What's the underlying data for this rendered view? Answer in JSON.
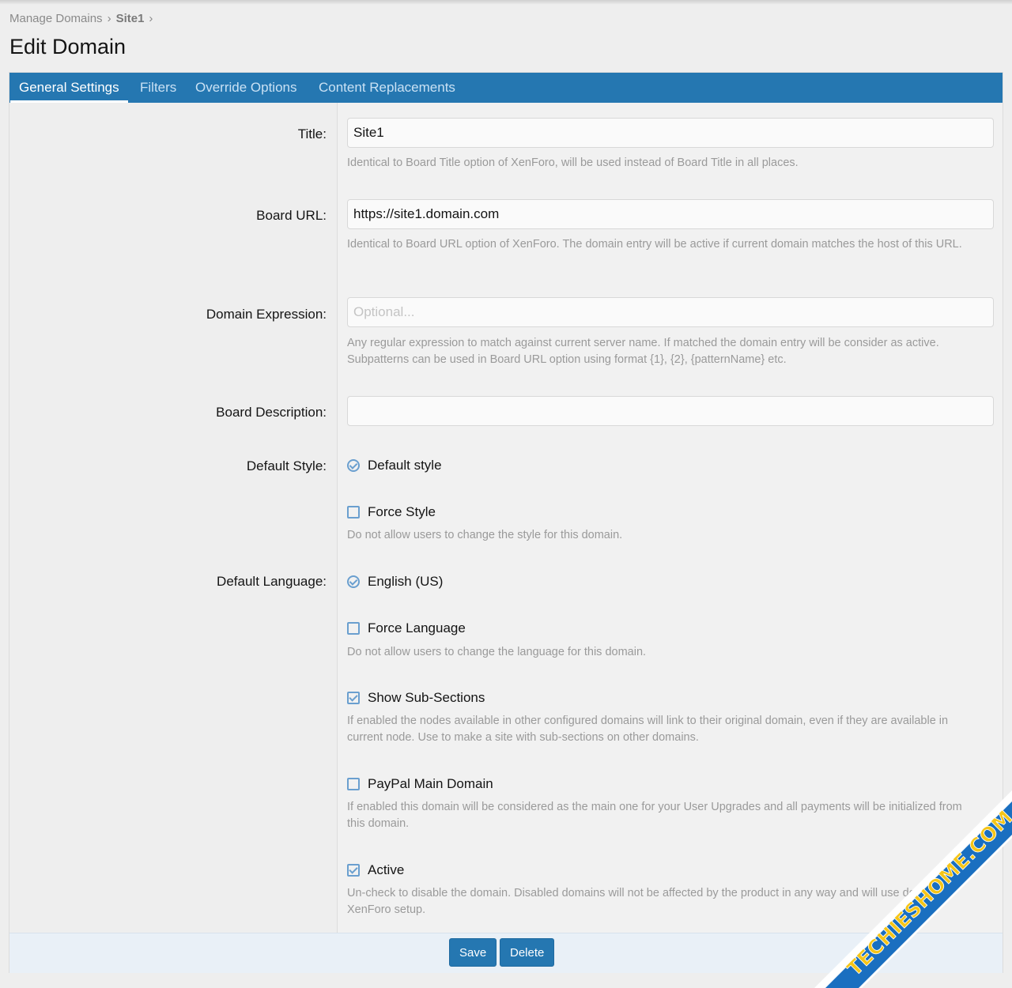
{
  "breadcrumb": {
    "parent": "Manage Domains",
    "separator": "›",
    "current": "Site1"
  },
  "page": {
    "title": "Edit Domain"
  },
  "tabs": [
    {
      "label": "General Settings",
      "active": true
    },
    {
      "label": "Filters",
      "active": false
    },
    {
      "label": "Override Options",
      "active": false
    },
    {
      "label": "Content Replacements",
      "active": false
    }
  ],
  "fields": {
    "title": {
      "label": "Title:",
      "value": "Site1",
      "hint": "Identical to Board Title option of XenForo, will be used instead of Board Title in all places."
    },
    "board_url": {
      "label": "Board URL:",
      "value": "https://site1.domain.com",
      "hint": "Identical to Board URL option of XenForo. The domain entry will be active if current domain matches the host of this URL."
    },
    "domain_expression": {
      "label": "Domain Expression:",
      "value": "",
      "placeholder": "Optional...",
      "hint": "Any regular expression to match against current server name. If matched the domain entry will be consider as active. Subpatterns can be used in Board URL option using format {1}, {2}, {patternName} etc."
    },
    "board_description": {
      "label": "Board Description:",
      "value": ""
    },
    "default_style": {
      "label": "Default Style:",
      "selected": "Default style",
      "force_label": "Force Style",
      "force_checked": false,
      "force_hint": "Do not allow users to change the style for this domain."
    },
    "default_language": {
      "label": "Default Language:",
      "selected": "English (US)",
      "force_label": "Force Language",
      "force_checked": false,
      "force_hint": "Do not allow users to change the language for this domain."
    },
    "show_sub_sections": {
      "label": "Show Sub-Sections",
      "checked": true,
      "hint": "If enabled the nodes available in other configured domains will link to their original domain, even if they are available in current node. Use to make a site with sub-sections on other domains."
    },
    "paypal_main_domain": {
      "label": "PayPal Main Domain",
      "checked": false,
      "hint": "If enabled this domain will be considered as the main one for your User Upgrades and all payments will be initialized from this domain."
    },
    "active": {
      "label": "Active",
      "checked": true,
      "hint": "Un-check to disable the domain. Disabled domains will not be affected by the product in any way and will use default XenForo setup."
    }
  },
  "actions": {
    "save_label": "Save",
    "delete_label": "Delete"
  },
  "colors": {
    "accent": "#2577b1",
    "checkbox": "#6a9fcf",
    "hint_text": "#9a9a9a"
  },
  "watermark": {
    "text": "TECHIESHOME.COM",
    "color": "#1a6fc0"
  }
}
